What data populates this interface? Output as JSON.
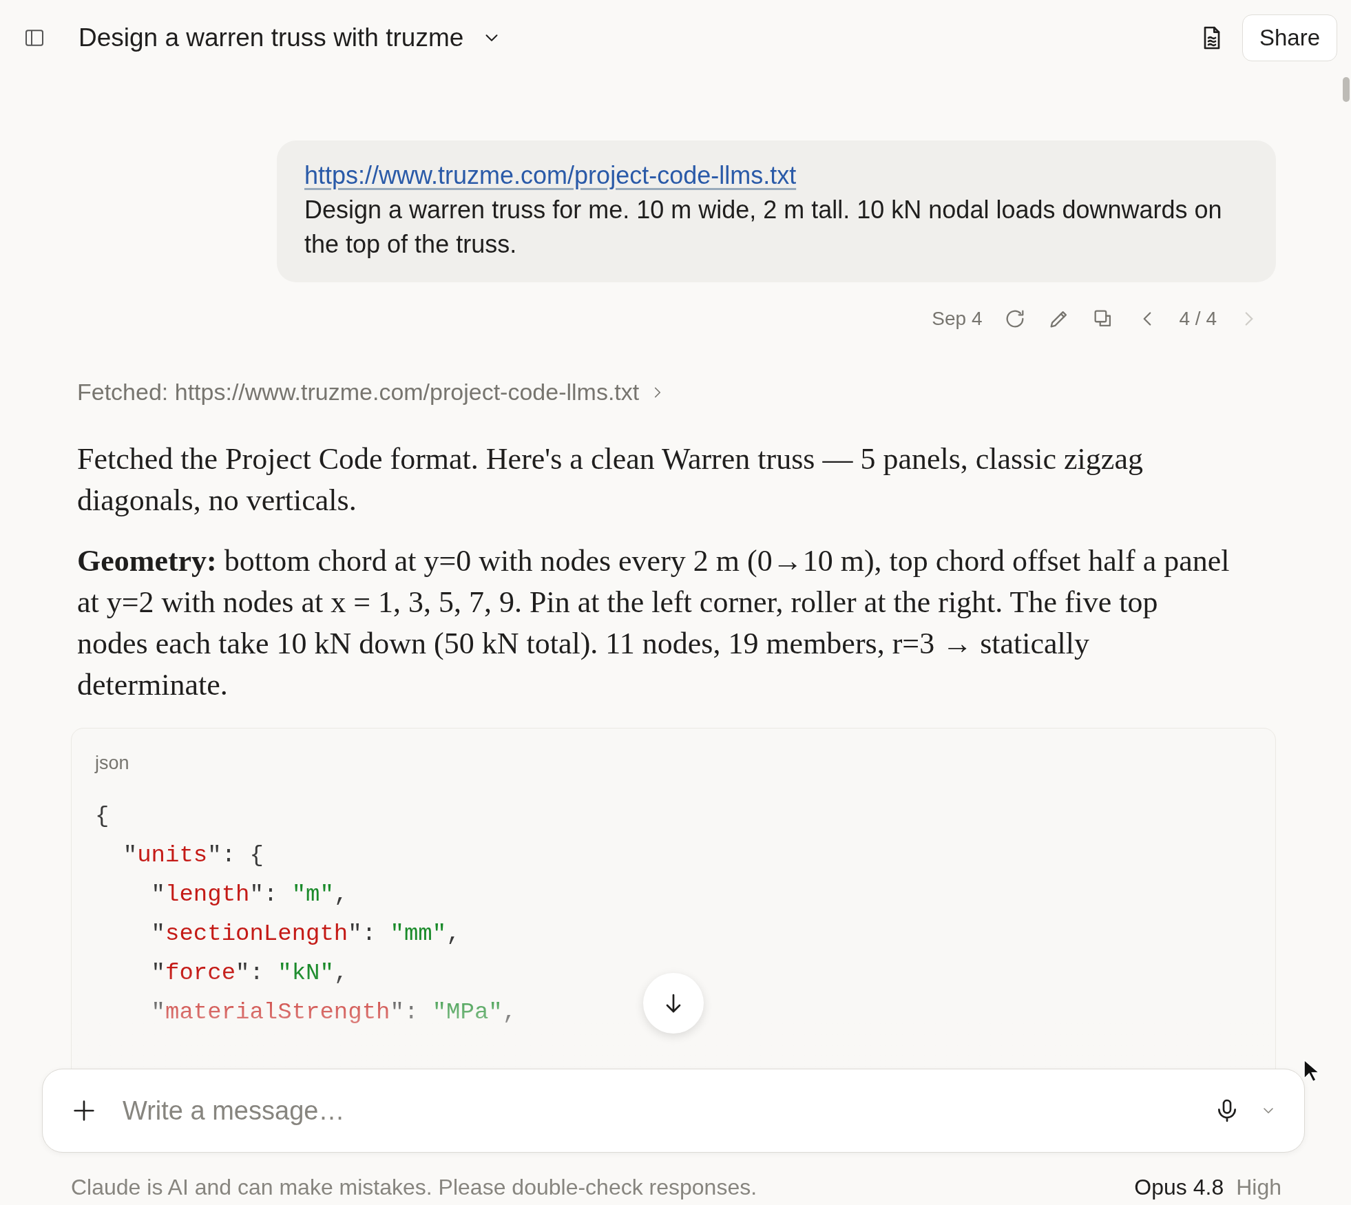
{
  "header": {
    "title": "Design a warren truss with truzme",
    "share_label": "Share"
  },
  "user_message": {
    "link": "https://www.truzme.com/project-code-llms.txt",
    "text": "Design a warren truss for me. 10 m wide, 2 m tall. 10 kN nodal loads downwards on the top of the truss.",
    "date": "Sep 4",
    "version": "4 / 4",
    "next_disabled": true
  },
  "fetched": {
    "label": "Fetched: https://www.truzme.com/project-code-llms.txt"
  },
  "paragraphs": [
    "Fetched the Project Code format. Here's a clean Warren truss — 5 panels, classic zigzag diagonals, no verticals.",
    "**Geometry:** bottom chord at y=0 with nodes every 2 m (0→10 m), top chord offset half a panel at y=2 with nodes at x = 1, 3, 5, 7, 9. Pin at the left corner, roller at the right. The five top nodes each take 10 kN down (50 kN total). 11 nodes, 19 members, r=3 → statically determinate."
  ],
  "code_block": {
    "language": "json",
    "lines": [
      [
        {
          "kind": "punct",
          "text": "{"
        }
      ],
      [
        {
          "kind": "punct",
          "text": "  \""
        },
        {
          "kind": "key",
          "text": "units"
        },
        {
          "kind": "punct",
          "text": "\": {"
        }
      ],
      [
        {
          "kind": "punct",
          "text": "    \""
        },
        {
          "kind": "key",
          "text": "length"
        },
        {
          "kind": "punct",
          "text": "\": "
        },
        {
          "kind": "string",
          "text": "\"m\""
        },
        {
          "kind": "punct",
          "text": ","
        }
      ],
      [
        {
          "kind": "punct",
          "text": "    \""
        },
        {
          "kind": "key",
          "text": "sectionLength"
        },
        {
          "kind": "punct",
          "text": "\": "
        },
        {
          "kind": "string",
          "text": "\"mm\""
        },
        {
          "kind": "punct",
          "text": ","
        }
      ],
      [
        {
          "kind": "punct",
          "text": "    \""
        },
        {
          "kind": "key",
          "text": "force"
        },
        {
          "kind": "punct",
          "text": "\": "
        },
        {
          "kind": "string",
          "text": "\"kN\""
        },
        {
          "kind": "punct",
          "text": ","
        }
      ],
      [
        {
          "kind": "punct",
          "text": "    \""
        },
        {
          "kind": "key",
          "text": "materialStrength"
        },
        {
          "kind": "punct",
          "text": "\": "
        },
        {
          "kind": "string",
          "text": "\"MPa\""
        },
        {
          "kind": "punct",
          "text": ","
        }
      ]
    ]
  },
  "composer": {
    "placeholder": "Write a message…"
  },
  "footer": {
    "disclaimer": "Claude is AI and can make mistakes. Please double-check responses.",
    "model": "Opus 4.8",
    "effort": "High"
  }
}
